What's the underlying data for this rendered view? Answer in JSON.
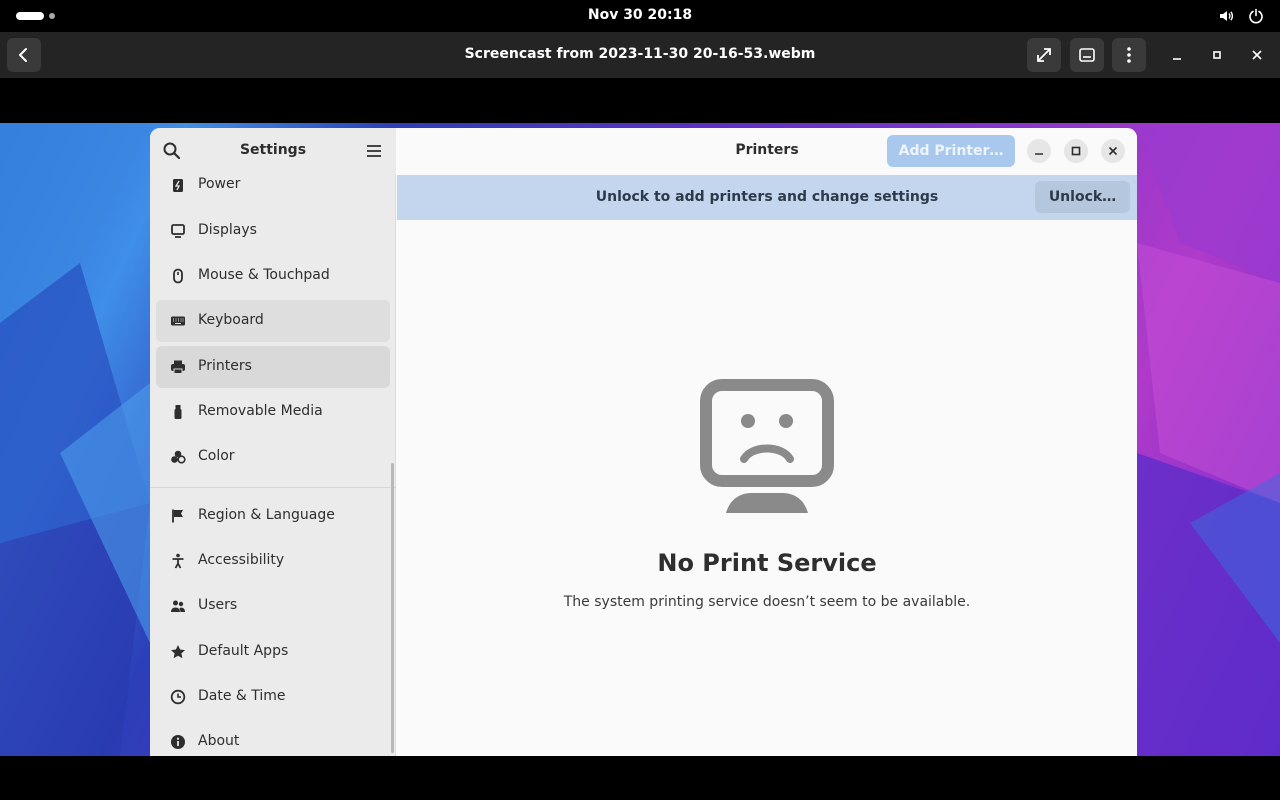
{
  "topbar": {
    "clock": "Nov 30  20:18"
  },
  "player": {
    "title": "Screencast from 2023-11-30 20-16-53.webm"
  },
  "settings": {
    "sidebar_title": "Settings",
    "sidebar_items": [
      {
        "label": "Power",
        "icon": "power-icon"
      },
      {
        "label": "Displays",
        "icon": "display-icon"
      },
      {
        "label": "Mouse & Touchpad",
        "icon": "mouse-icon"
      },
      {
        "label": "Keyboard",
        "icon": "keyboard-icon"
      },
      {
        "label": "Printers",
        "icon": "printer-icon"
      },
      {
        "label": "Removable Media",
        "icon": "usb-icon"
      },
      {
        "label": "Color",
        "icon": "color-icon"
      },
      {
        "label": "Region & Language",
        "icon": "flag-icon"
      },
      {
        "label": "Accessibility",
        "icon": "accessibility-icon"
      },
      {
        "label": "Users",
        "icon": "users-icon"
      },
      {
        "label": "Default Apps",
        "icon": "star-icon"
      },
      {
        "label": "Date & Time",
        "icon": "clock-icon"
      },
      {
        "label": "About",
        "icon": "info-icon"
      }
    ],
    "selected_item": "Printers",
    "main_title": "Printers",
    "add_printer_label": "Add Printer…",
    "infobar_text": "Unlock to add printers and change settings",
    "unlock_label": "Unlock…",
    "empty_title": "No Print Service",
    "empty_description": "The system printing service doesn’t seem to be available."
  },
  "colors": {
    "accent_disabled": "#a9c8ee",
    "infobar_bg": "#c3d6ee"
  }
}
